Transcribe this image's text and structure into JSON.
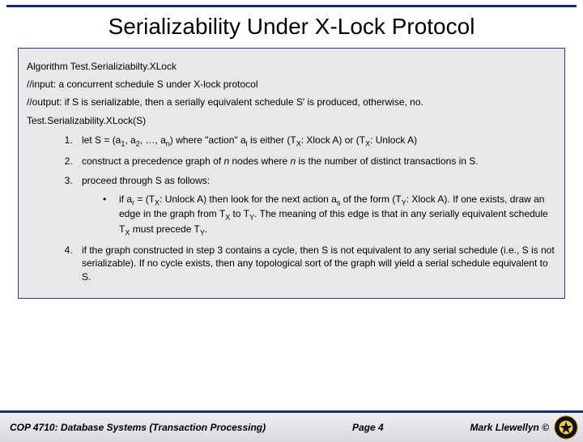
{
  "title": "Serializability Under X-Lock Protocol",
  "algorithm": {
    "name": "Algorithm Test.Serializiabilty.XLock",
    "input": "//input:  a concurrent schedule S under X-lock protocol",
    "output_prefix": "//output: if S is serializable, then a serially equivalent schedule S",
    "output_suffix": " is produced, otherwise, no.",
    "call": "Test.Serializability.XLock(S)",
    "steps": {
      "s1_prefix": "let S = (a",
      "s1_mid1": ", a",
      "s1_mid2": ", …, a",
      "s1_mid3": ") where \"action\" a",
      "s1_mid4": " is either (T",
      "s1_mid5": ": Xlock A) or (T",
      "s1_suffix": ": Unlock A)",
      "s2_a": "construct a precedence graph of ",
      "s2_b": " nodes where ",
      "s2_c": " is the number of distinct transactions in S.",
      "s2_n": "n",
      "s3": "proceed through S as follows:",
      "s3_sub_a": "if a",
      "s3_sub_b": " = (T",
      "s3_sub_c": ": Unlock A) then look for the next action a",
      "s3_sub_d": " of the form (T",
      "s3_sub_e": ": Xlock A). If one exists, draw an edge in the graph from T",
      "s3_sub_f": " to T",
      "s3_sub_g": ".  The meaning of this edge is that in any serially equivalent schedule T",
      "s3_sub_h": " must precede T",
      "s3_sub_i": ".",
      "s4": "if the graph constructed in step 3 contains a cycle, then S is not equivalent to any serial schedule (i.e., S is not serializable).  If no cycle exists, then any topological sort of the graph will yield a serial schedule equivalent to S."
    }
  },
  "footer": {
    "course": "COP 4710: Database Systems  (Transaction Processing)",
    "page": "Page 4",
    "author": "Mark Llewellyn ©"
  }
}
